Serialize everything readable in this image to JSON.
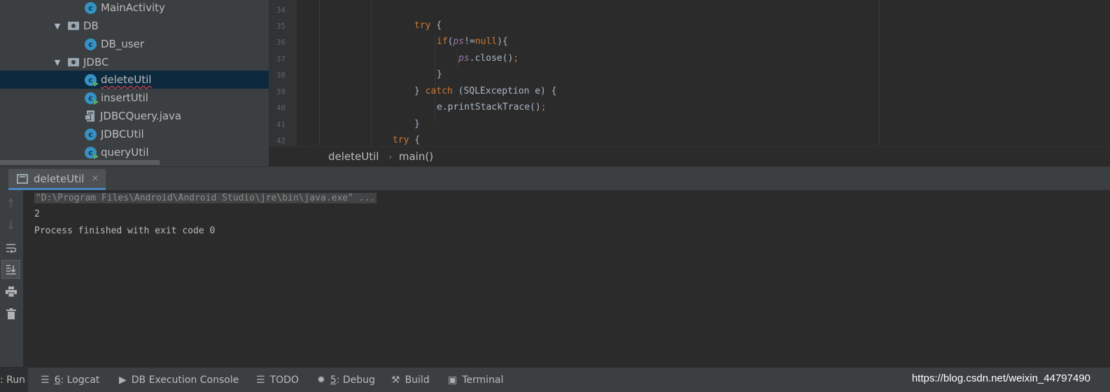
{
  "project_tree": {
    "items": [
      {
        "label": "MainActivity",
        "type": "class"
      },
      {
        "label": "DB",
        "type": "package"
      },
      {
        "label": "DB_user",
        "type": "class"
      },
      {
        "label": "JDBC",
        "type": "package"
      },
      {
        "label": "deleteUtil",
        "type": "runnable-class",
        "selected": true
      },
      {
        "label": "insertUtil",
        "type": "runnable-class"
      },
      {
        "label": "JDBCQuery.java",
        "type": "java-file"
      },
      {
        "label": "JDBCUtil",
        "type": "class"
      },
      {
        "label": "queryUtil",
        "type": "runnable-class"
      }
    ],
    "class_icon_letter": "c"
  },
  "editor": {
    "line_numbers": [
      "34",
      "35",
      "36",
      "37",
      "38",
      "39",
      "40",
      "41",
      "42"
    ],
    "code": {
      "l35_kw": "try",
      "l35_rest": " {",
      "l36_kw": "if",
      "l36_open": "(",
      "l36_var": "ps",
      "l36_op": "!=",
      "l36_null": "null",
      "l36_close": "){",
      "l37_var": "ps",
      "l37_call": ".close()",
      "l37_semi": ";",
      "l38": "}",
      "l39_brace": "} ",
      "l39_kw": "catch",
      "l39_rest": " (SQLException e) {",
      "l40_call": "e.printStackTrace()",
      "l40_semi": ";",
      "l41": "}",
      "l42_kw": "try",
      "l42_rest": " {"
    },
    "breadcrumb": [
      "deleteUtil",
      "main()"
    ]
  },
  "run_panel": {
    "tab_label": "deleteUtil",
    "tab_close": "×",
    "console_lines": [
      "\"D:\\Program Files\\Android\\Android Studio\\jre\\bin\\java.exe\" ...",
      "2",
      "Process finished with exit code 0"
    ],
    "toolbar_icons": [
      "arrow-up-icon",
      "arrow-down-icon",
      "soft-wrap-icon",
      "scroll-to-end-icon",
      "print-icon",
      "trash-icon"
    ]
  },
  "bottom_bar": {
    "run": ": Run",
    "logcat_num": "6",
    "logcat_label": ": Logcat",
    "db_console": "DB Execution Console",
    "todo": "TODO",
    "debug_num": "5",
    "debug_label": ": Debug",
    "build": "Build",
    "terminal": "Terminal"
  },
  "watermark": "https://blog.csdn.net/weixin_44797490",
  "colors": {
    "tree_bg": "#3c3f41",
    "editor_bg": "#2b2b2b",
    "selection": "#0d293e",
    "keyword": "#cc7832",
    "variable": "#9876aa",
    "class_icon": "#3592c4"
  }
}
